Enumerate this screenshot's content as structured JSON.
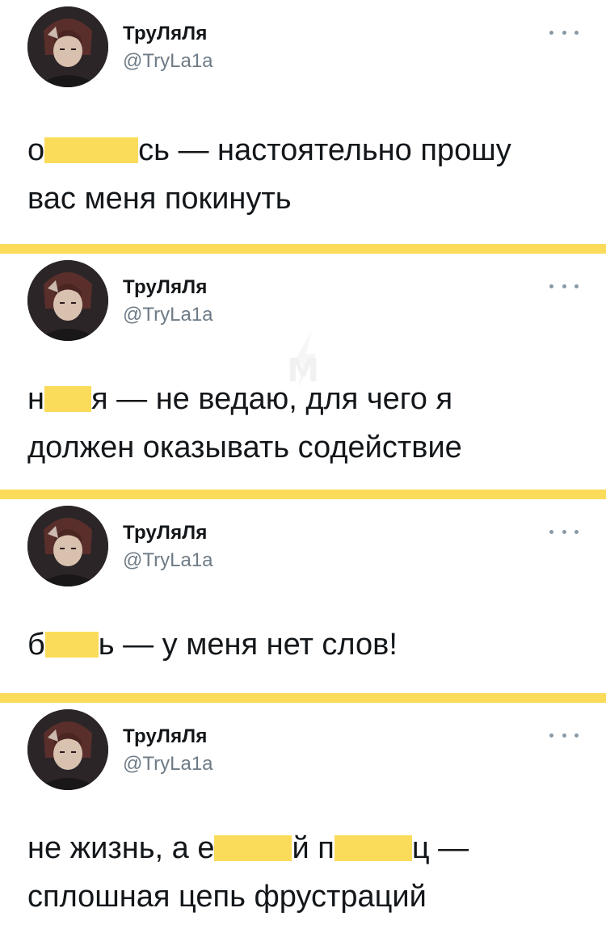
{
  "tweets": [
    {
      "display_name": "ТруЛяЛя",
      "handle": "@TryLa1a",
      "lines": [
        {
          "before": "о",
          "censored": true,
          "after": "сь — настоятельно прошу"
        },
        {
          "before": "вас меня покинуть",
          "censored": false,
          "after": ""
        }
      ]
    },
    {
      "display_name": "ТруЛяЛя",
      "handle": "@TryLa1a",
      "lines": [
        {
          "before": "н",
          "censored": true,
          "after": "я — не ведаю, для чего я"
        },
        {
          "before": "должен оказывать содействие",
          "censored": false,
          "after": ""
        }
      ]
    },
    {
      "display_name": "ТруЛяЛя",
      "handle": "@TryLa1a",
      "lines": [
        {
          "before": "б",
          "censored": true,
          "after": "ь — у меня нет слов!"
        }
      ]
    },
    {
      "display_name": "ТруЛяЛя",
      "handle": "@TryLa1a",
      "lines": [
        {
          "before": "не жизнь, а е",
          "censored": true,
          "mid": "й п",
          "censored2": true,
          "after": "ц —"
        },
        {
          "before": "сплошная цепь фрустраций",
          "censored": false,
          "after": ""
        }
      ]
    }
  ],
  "watermark_letter": "M",
  "colors": {
    "divider": "#fbdc5a",
    "censor": "#fbdc5a",
    "handle": "#6e7b86",
    "text": "#14171a"
  },
  "icons": {
    "more": "more-horizontal-icon",
    "avatar": "avatar-anime-character"
  }
}
